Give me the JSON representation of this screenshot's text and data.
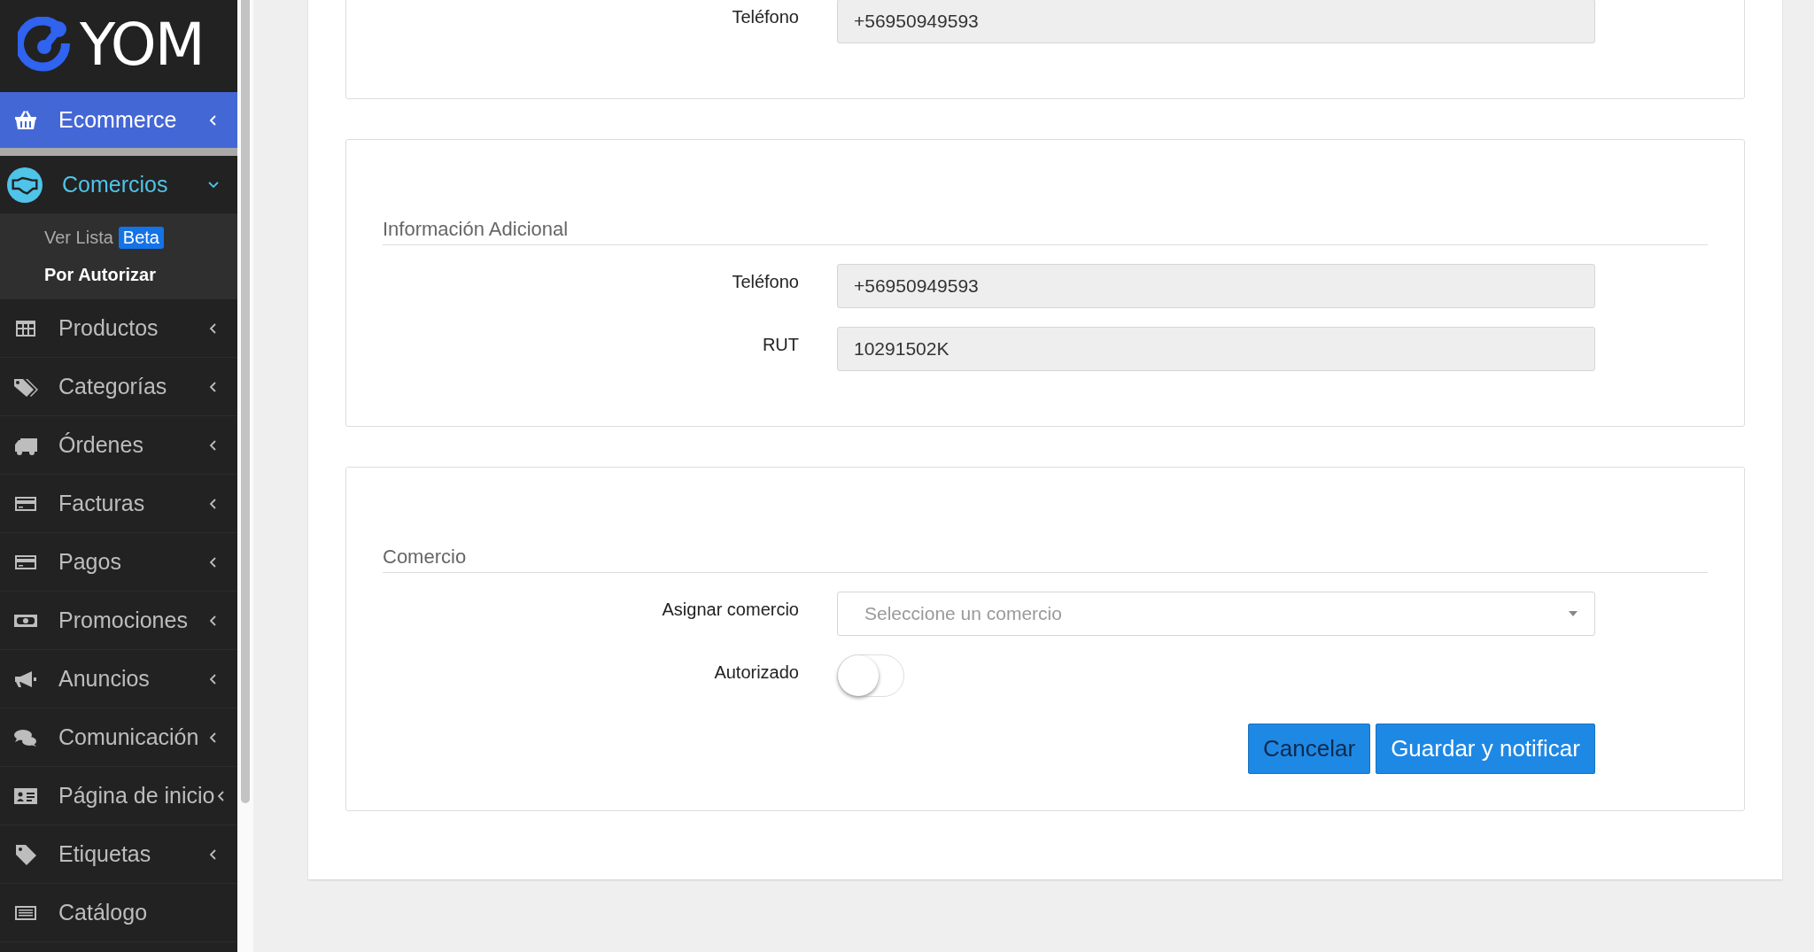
{
  "logo": {
    "text": "YOM"
  },
  "sidebar": {
    "items": [
      {
        "label": "Ecommerce",
        "selected": true,
        "expanded": false,
        "caret": true
      },
      {
        "label": "Comercios",
        "selected": false,
        "expanded": true,
        "caret": true,
        "children": [
          {
            "label": "Ver Lista",
            "badge": "Beta",
            "selected": false
          },
          {
            "label": "Por Autorizar",
            "selected": true
          }
        ]
      },
      {
        "label": "Productos",
        "selected": false,
        "expanded": false,
        "caret": true
      },
      {
        "label": "Categorías",
        "selected": false,
        "expanded": false,
        "caret": true
      },
      {
        "label": "Órdenes",
        "selected": false,
        "expanded": false,
        "caret": true
      },
      {
        "label": "Facturas",
        "selected": false,
        "expanded": false,
        "caret": true
      },
      {
        "label": "Pagos",
        "selected": false,
        "expanded": false,
        "caret": true
      },
      {
        "label": "Promociones",
        "selected": false,
        "expanded": false,
        "caret": true
      },
      {
        "label": "Anuncios",
        "selected": false,
        "expanded": false,
        "caret": true
      },
      {
        "label": "Comunicación",
        "selected": false,
        "expanded": false,
        "caret": true
      },
      {
        "label": "Página de inicio",
        "selected": false,
        "expanded": false,
        "caret": true
      },
      {
        "label": "Etiquetas",
        "selected": false,
        "expanded": false,
        "caret": true
      },
      {
        "label": "Catálogo",
        "selected": false,
        "expanded": false,
        "caret": false
      }
    ]
  },
  "panels": [
    {
      "fields": [
        {
          "kind": "text",
          "label": "Teléfono",
          "value": "+56950949593",
          "disabled": true
        }
      ]
    },
    {
      "title": "Información Adicional",
      "fields": [
        {
          "kind": "text",
          "label": "Teléfono",
          "value": "+56950949593",
          "disabled": true
        },
        {
          "kind": "text",
          "label": "RUT",
          "value": "10291502K",
          "disabled": true
        }
      ]
    },
    {
      "title": "Comercio",
      "fields": [
        {
          "kind": "select",
          "label": "Asignar comercio",
          "placeholder": "Seleccione un comercio"
        },
        {
          "kind": "toggle",
          "label": "Autorizado",
          "on": false
        }
      ],
      "buttons": [
        {
          "label": "Cancelar",
          "kind": "secondary"
        },
        {
          "label": "Guardar y notificar",
          "kind": "primary"
        }
      ]
    }
  ]
}
